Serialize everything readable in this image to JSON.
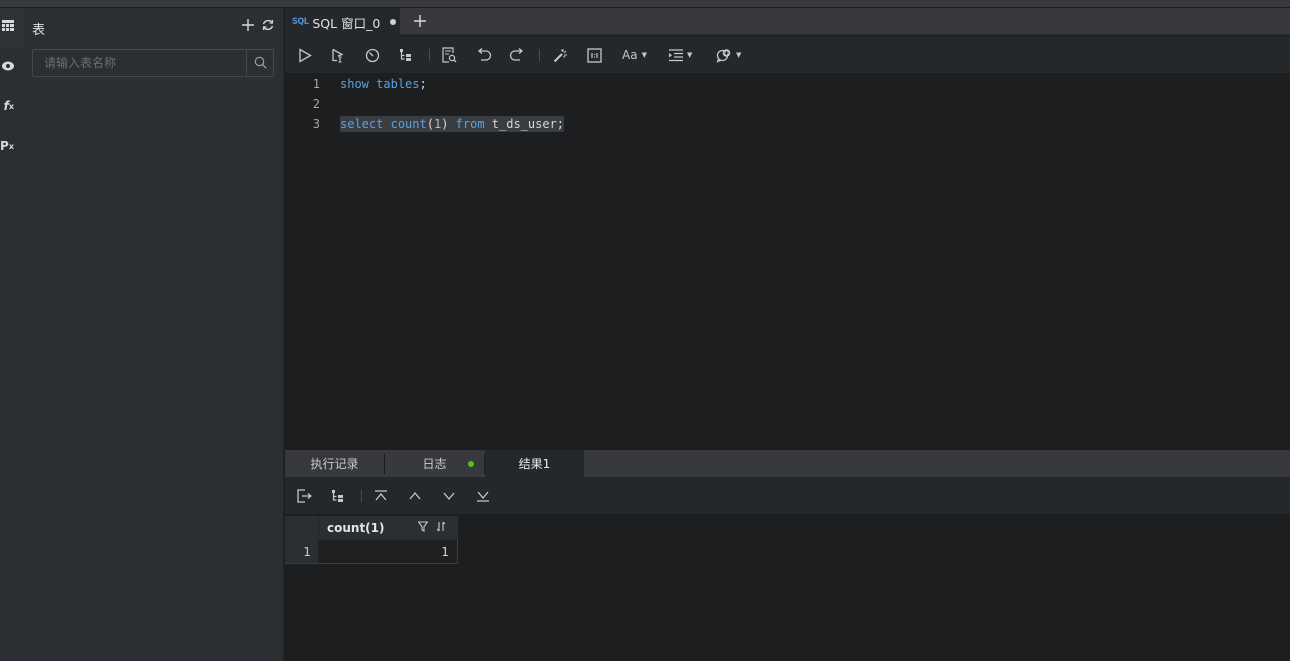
{
  "rail": {
    "icons": [
      "table-icon",
      "view-icon",
      "function-icon",
      "procedure-icon"
    ]
  },
  "sidebar": {
    "title": "表",
    "search_placeholder": "请输入表名称",
    "search_value": ""
  },
  "editor_tabs": [
    {
      "icon": "SQL",
      "label": "SQL 窗口_0",
      "modified": true
    }
  ],
  "toolbar": {
    "buttons": [
      "run",
      "run-selected",
      "history",
      "explain",
      "format-check",
      "undo",
      "redo",
      "beautify",
      "sql-block",
      "font-size",
      "indent",
      "snippets"
    ],
    "font_size_label": "Aa"
  },
  "editor": {
    "lines": [
      {
        "n": "1",
        "tokens": [
          {
            "t": "show",
            "c": "kw"
          },
          {
            "t": " ",
            "c": ""
          },
          {
            "t": "tables",
            "c": "kw"
          },
          {
            "t": ";",
            "c": ""
          }
        ]
      },
      {
        "n": "2",
        "tokens": []
      },
      {
        "n": "3",
        "tokens": [
          {
            "t": "select",
            "c": "kw"
          },
          {
            "t": " ",
            "c": ""
          },
          {
            "t": "count",
            "c": "kw"
          },
          {
            "t": "(",
            "c": ""
          },
          {
            "t": "1",
            "c": "num"
          },
          {
            "t": ") ",
            "c": ""
          },
          {
            "t": "from",
            "c": "kw"
          },
          {
            "t": " t_ds_user;",
            "c": ""
          }
        ],
        "selected": true
      }
    ]
  },
  "bottom_tabs": [
    {
      "label": "执行记录",
      "active": false
    },
    {
      "label": "日志",
      "active": false,
      "status_dot": "#52c41a"
    },
    {
      "label": "结果1",
      "active": true
    }
  ],
  "result": {
    "columns": [
      "count(1)"
    ],
    "rows": [
      {
        "index": "1",
        "values": [
          "1"
        ]
      }
    ]
  }
}
